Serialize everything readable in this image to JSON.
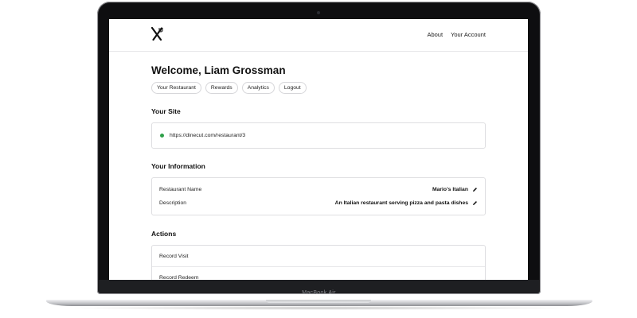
{
  "device": {
    "brand_label": "MacBook Air"
  },
  "nav": {
    "logo_icon": "fork-knife-icon",
    "links": [
      "About",
      "Your Account"
    ]
  },
  "welcome": {
    "heading": "Welcome, Liam Grossman"
  },
  "tabs": [
    "Your Restaurant",
    "Rewards",
    "Analytics",
    "Logout"
  ],
  "site": {
    "title": "Your Site",
    "status_color": "#2fa04a",
    "url": "https://dinecut.com/restaurant/3"
  },
  "information": {
    "title": "Your Information",
    "rows": [
      {
        "label": "Restaurant Name",
        "value": "Mario's Italian",
        "icon": "pencil-icon"
      },
      {
        "label": "Description",
        "value": "An Italian restaurant serving pizza and pasta dishes",
        "icon": "pencil-icon"
      }
    ]
  },
  "actions": {
    "title": "Actions",
    "items": [
      "Record Visit",
      "Record Redeem"
    ]
  }
}
